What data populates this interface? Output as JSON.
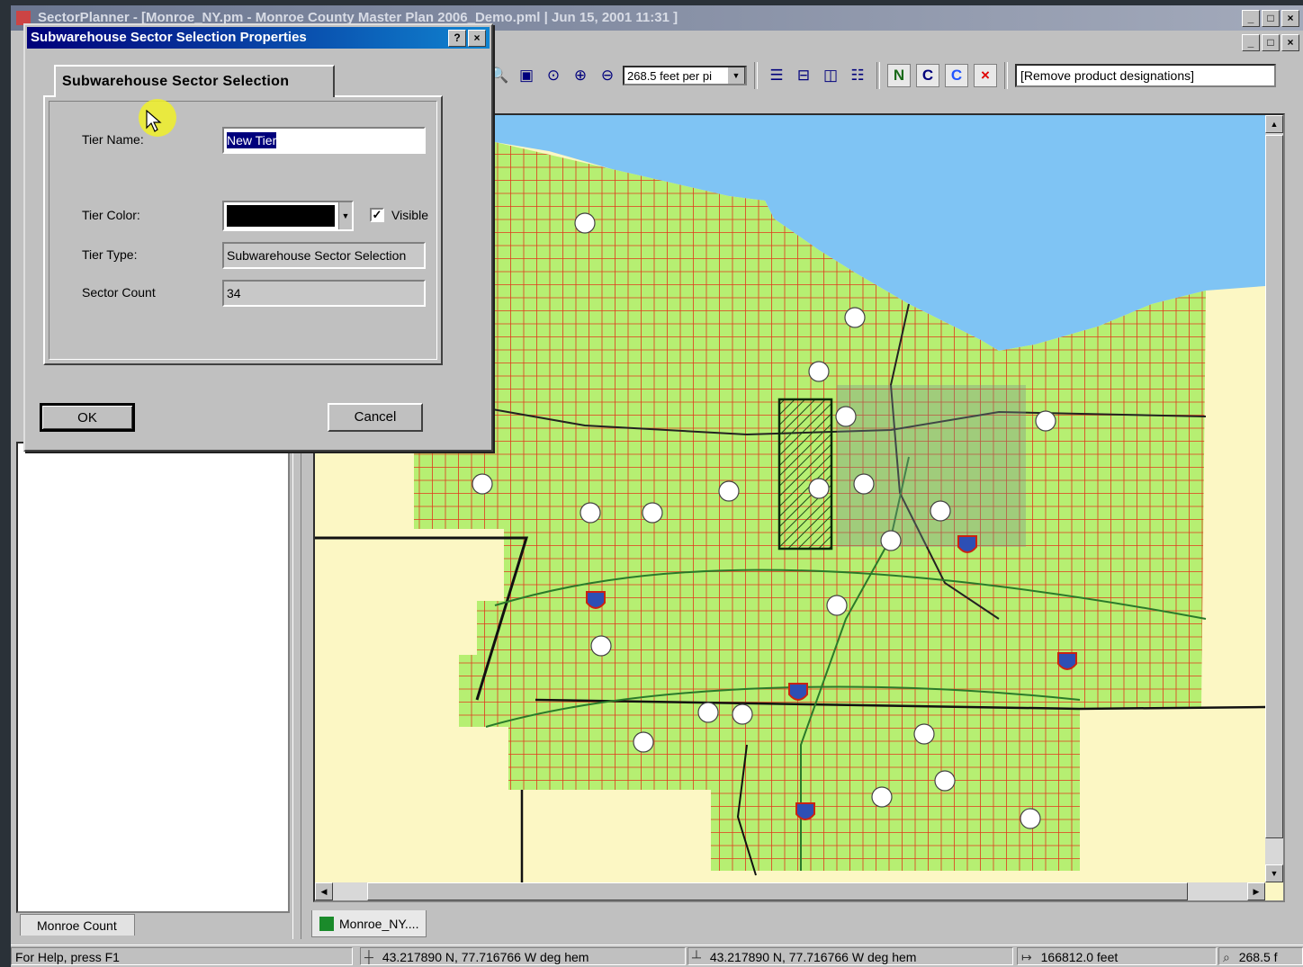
{
  "app": {
    "title": "SectorPlanner - [Monroe_NY.pm - Monroe County Master Plan 2006_Demo.pml | Jun 15, 2001 11:31 ]",
    "window_buttons": [
      "_",
      "□",
      "×"
    ]
  },
  "toolbar": {
    "scale_value": "268.5 feet per pi",
    "tool_labels": [
      "N",
      "C",
      "C",
      "×"
    ],
    "product_designations": "[Remove product designations]"
  },
  "dialog": {
    "title": "Subwarehouse Sector Selection Properties",
    "help_btn": "?",
    "close_btn": "×",
    "tab_label": "Subwarehouse Sector Selection",
    "tier_name_label": "Tier Name:",
    "tier_name_value": "New Tier",
    "tier_color_label": "Tier Color:",
    "tier_color": "#000000",
    "visible_label": "Visible",
    "visible_checked": true,
    "tier_type_label": "Tier Type:",
    "tier_type_value": "Subwarehouse Sector Selection",
    "sector_count_label": "Sector Count",
    "sector_count_value": "34",
    "ok_label": "OK",
    "cancel_label": "Cancel"
  },
  "left_panel": {
    "tab_label": "Monroe Count"
  },
  "map": {
    "tab_label": "Monroe_NY....",
    "colors": {
      "land": "#fcf7c4",
      "water": "#7fc4f4",
      "sector_fill": "#b6ef72",
      "grid_line": "#e03a1e",
      "highlight_hatch": "#1a4a1a"
    }
  },
  "statusbar": {
    "help_text": "For Help, press F1",
    "cursor_coords": "43.217890 N, 77.716766 W  deg hem",
    "anchor_coords": "43.217890 N, 77.716766 W  deg hem",
    "distance": "166812.0 feet",
    "zoom": "268.5 f"
  }
}
